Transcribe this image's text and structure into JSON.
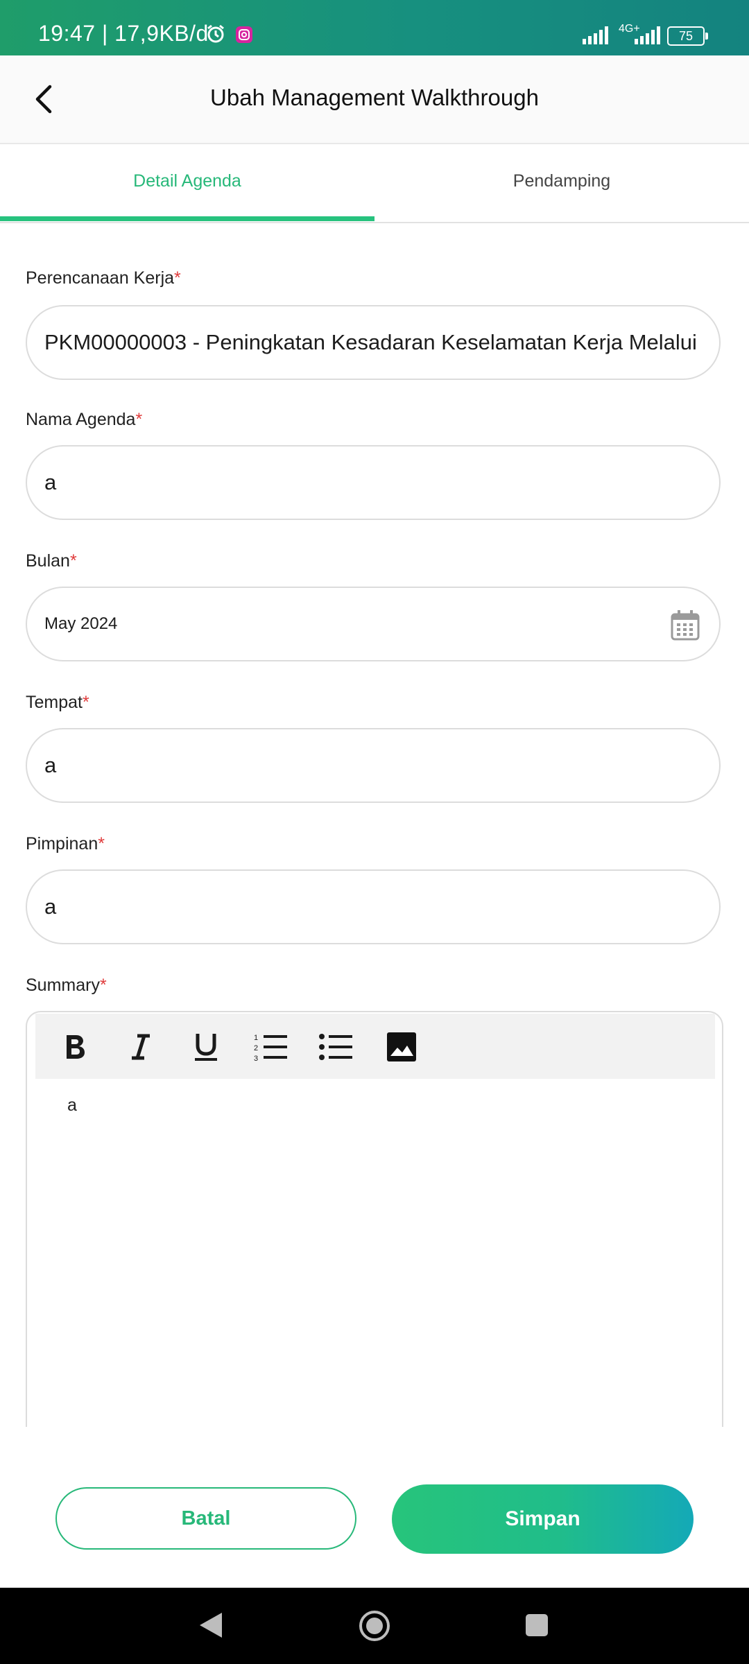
{
  "status_bar": {
    "time": "19:47 | 17,9KB/d",
    "network": "4G+",
    "battery": "75"
  },
  "header": {
    "title": "Ubah Management Walkthrough"
  },
  "tabs": [
    {
      "label": "Detail Agenda",
      "active": true
    },
    {
      "label": "Pendamping",
      "active": false
    }
  ],
  "form": {
    "perencanaan": {
      "label": "Perencanaan Kerja",
      "required": "*",
      "value": "PKM00000003 - Peningkatan Kesadaran Keselamatan Kerja Melalui"
    },
    "nama_agenda": {
      "label": "Nama Agenda",
      "required": "*",
      "value": "a"
    },
    "bulan": {
      "label": "Bulan",
      "required": "*",
      "value": "May 2024"
    },
    "tempat": {
      "label": "Tempat",
      "required": "*",
      "value": "a"
    },
    "pimpinan": {
      "label": "Pimpinan",
      "required": "*",
      "value": "a"
    },
    "summary": {
      "label": "Summary",
      "required": "*",
      "value": "a"
    }
  },
  "toolbar_icons": [
    "bold-icon",
    "italic-icon",
    "underline-icon",
    "ordered-list-icon",
    "bullet-list-icon",
    "image-icon"
  ],
  "buttons": {
    "cancel": "Batal",
    "save": "Simpan"
  },
  "colors": {
    "accent": "#27b879",
    "required": "#e03c3c"
  }
}
